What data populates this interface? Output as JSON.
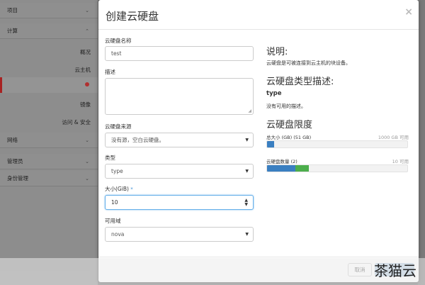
{
  "sidebar": {
    "section_project": "项目",
    "section_compute": "计算",
    "compute_items": [
      "概况",
      "云主机",
      "",
      "镜像",
      "访问 & 安全"
    ],
    "section_network": "网络",
    "section_admin": "管理员",
    "section_identity": "身份管理"
  },
  "modal": {
    "title": "创建云硬盘",
    "close_symbol": "×",
    "form": {
      "name_label": "云硬盘名称",
      "name_value": "test",
      "description_label": "描述",
      "description_value": "",
      "source_label": "云硬盘来源",
      "source_value": "没有源，空白云硬盘。",
      "type_label": "类型",
      "type_value": "type",
      "size_label": "大小(GiB)",
      "size_required_mark": "*",
      "size_value": "10",
      "az_label": "可用域",
      "az_value": "nova"
    },
    "info": {
      "heading_desc": "说明:",
      "desc_text": "云硬盘是可被连接到云主机的块设备。",
      "heading_type_desc": "云硬盘类型描述:",
      "type_name": "type",
      "type_text": "没有可用的描述。",
      "heading_limits": "云硬盘限度",
      "total_size_label": "总大小 (GB)",
      "total_size_used": "(51 GB)",
      "total_size_max": "1000 GB 可用",
      "total_size_fraction": 0.051,
      "count_label": "云硬盘数量",
      "count_used": "(2)",
      "count_max": "10 可用",
      "count_fraction_used": 0.2,
      "count_fraction_new": 0.1
    },
    "footer": {
      "cancel_label": "取消",
      "create_label": ""
    }
  },
  "watermark": "茶猫云",
  "colors": {
    "bar_used": "#3a7fc1",
    "bar_new": "#4cae4c",
    "focus_border": "#66afe9",
    "primary": "#2e6da4"
  }
}
